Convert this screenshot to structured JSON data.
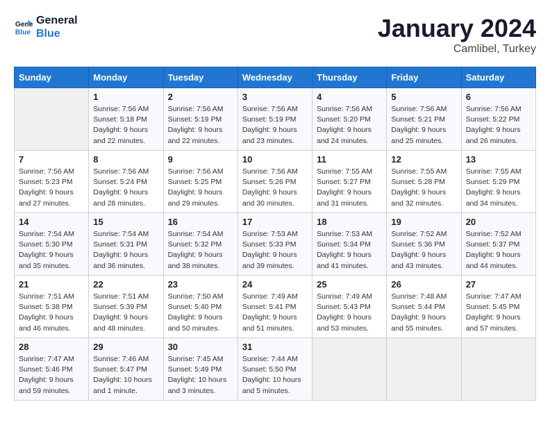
{
  "header": {
    "logo_line1": "General",
    "logo_line2": "Blue",
    "title": "January 2024",
    "subtitle": "Camlibel, Turkey"
  },
  "weekdays": [
    "Sunday",
    "Monday",
    "Tuesday",
    "Wednesday",
    "Thursday",
    "Friday",
    "Saturday"
  ],
  "weeks": [
    [
      {
        "day": "",
        "sunrise": "",
        "sunset": "",
        "daylight": ""
      },
      {
        "day": "1",
        "sunrise": "Sunrise: 7:56 AM",
        "sunset": "Sunset: 5:18 PM",
        "daylight": "Daylight: 9 hours and 22 minutes."
      },
      {
        "day": "2",
        "sunrise": "Sunrise: 7:56 AM",
        "sunset": "Sunset: 5:19 PM",
        "daylight": "Daylight: 9 hours and 22 minutes."
      },
      {
        "day": "3",
        "sunrise": "Sunrise: 7:56 AM",
        "sunset": "Sunset: 5:19 PM",
        "daylight": "Daylight: 9 hours and 23 minutes."
      },
      {
        "day": "4",
        "sunrise": "Sunrise: 7:56 AM",
        "sunset": "Sunset: 5:20 PM",
        "daylight": "Daylight: 9 hours and 24 minutes."
      },
      {
        "day": "5",
        "sunrise": "Sunrise: 7:56 AM",
        "sunset": "Sunset: 5:21 PM",
        "daylight": "Daylight: 9 hours and 25 minutes."
      },
      {
        "day": "6",
        "sunrise": "Sunrise: 7:56 AM",
        "sunset": "Sunset: 5:22 PM",
        "daylight": "Daylight: 9 hours and 26 minutes."
      }
    ],
    [
      {
        "day": "7",
        "sunrise": "Sunrise: 7:56 AM",
        "sunset": "Sunset: 5:23 PM",
        "daylight": "Daylight: 9 hours and 27 minutes."
      },
      {
        "day": "8",
        "sunrise": "Sunrise: 7:56 AM",
        "sunset": "Sunset: 5:24 PM",
        "daylight": "Daylight: 9 hours and 28 minutes."
      },
      {
        "day": "9",
        "sunrise": "Sunrise: 7:56 AM",
        "sunset": "Sunset: 5:25 PM",
        "daylight": "Daylight: 9 hours and 29 minutes."
      },
      {
        "day": "10",
        "sunrise": "Sunrise: 7:56 AM",
        "sunset": "Sunset: 5:26 PM",
        "daylight": "Daylight: 9 hours and 30 minutes."
      },
      {
        "day": "11",
        "sunrise": "Sunrise: 7:55 AM",
        "sunset": "Sunset: 5:27 PM",
        "daylight": "Daylight: 9 hours and 31 minutes."
      },
      {
        "day": "12",
        "sunrise": "Sunrise: 7:55 AM",
        "sunset": "Sunset: 5:28 PM",
        "daylight": "Daylight: 9 hours and 32 minutes."
      },
      {
        "day": "13",
        "sunrise": "Sunrise: 7:55 AM",
        "sunset": "Sunset: 5:29 PM",
        "daylight": "Daylight: 9 hours and 34 minutes."
      }
    ],
    [
      {
        "day": "14",
        "sunrise": "Sunrise: 7:54 AM",
        "sunset": "Sunset: 5:30 PM",
        "daylight": "Daylight: 9 hours and 35 minutes."
      },
      {
        "day": "15",
        "sunrise": "Sunrise: 7:54 AM",
        "sunset": "Sunset: 5:31 PM",
        "daylight": "Daylight: 9 hours and 36 minutes."
      },
      {
        "day": "16",
        "sunrise": "Sunrise: 7:54 AM",
        "sunset": "Sunset: 5:32 PM",
        "daylight": "Daylight: 9 hours and 38 minutes."
      },
      {
        "day": "17",
        "sunrise": "Sunrise: 7:53 AM",
        "sunset": "Sunset: 5:33 PM",
        "daylight": "Daylight: 9 hours and 39 minutes."
      },
      {
        "day": "18",
        "sunrise": "Sunrise: 7:53 AM",
        "sunset": "Sunset: 5:34 PM",
        "daylight": "Daylight: 9 hours and 41 minutes."
      },
      {
        "day": "19",
        "sunrise": "Sunrise: 7:52 AM",
        "sunset": "Sunset: 5:36 PM",
        "daylight": "Daylight: 9 hours and 43 minutes."
      },
      {
        "day": "20",
        "sunrise": "Sunrise: 7:52 AM",
        "sunset": "Sunset: 5:37 PM",
        "daylight": "Daylight: 9 hours and 44 minutes."
      }
    ],
    [
      {
        "day": "21",
        "sunrise": "Sunrise: 7:51 AM",
        "sunset": "Sunset: 5:38 PM",
        "daylight": "Daylight: 9 hours and 46 minutes."
      },
      {
        "day": "22",
        "sunrise": "Sunrise: 7:51 AM",
        "sunset": "Sunset: 5:39 PM",
        "daylight": "Daylight: 9 hours and 48 minutes."
      },
      {
        "day": "23",
        "sunrise": "Sunrise: 7:50 AM",
        "sunset": "Sunset: 5:40 PM",
        "daylight": "Daylight: 9 hours and 50 minutes."
      },
      {
        "day": "24",
        "sunrise": "Sunrise: 7:49 AM",
        "sunset": "Sunset: 5:41 PM",
        "daylight": "Daylight: 9 hours and 51 minutes."
      },
      {
        "day": "25",
        "sunrise": "Sunrise: 7:49 AM",
        "sunset": "Sunset: 5:43 PM",
        "daylight": "Daylight: 9 hours and 53 minutes."
      },
      {
        "day": "26",
        "sunrise": "Sunrise: 7:48 AM",
        "sunset": "Sunset: 5:44 PM",
        "daylight": "Daylight: 9 hours and 55 minutes."
      },
      {
        "day": "27",
        "sunrise": "Sunrise: 7:47 AM",
        "sunset": "Sunset: 5:45 PM",
        "daylight": "Daylight: 9 hours and 57 minutes."
      }
    ],
    [
      {
        "day": "28",
        "sunrise": "Sunrise: 7:47 AM",
        "sunset": "Sunset: 5:46 PM",
        "daylight": "Daylight: 9 hours and 59 minutes."
      },
      {
        "day": "29",
        "sunrise": "Sunrise: 7:46 AM",
        "sunset": "Sunset: 5:47 PM",
        "daylight": "Daylight: 10 hours and 1 minute."
      },
      {
        "day": "30",
        "sunrise": "Sunrise: 7:45 AM",
        "sunset": "Sunset: 5:49 PM",
        "daylight": "Daylight: 10 hours and 3 minutes."
      },
      {
        "day": "31",
        "sunrise": "Sunrise: 7:44 AM",
        "sunset": "Sunset: 5:50 PM",
        "daylight": "Daylight: 10 hours and 5 minutes."
      },
      {
        "day": "",
        "sunrise": "",
        "sunset": "",
        "daylight": ""
      },
      {
        "day": "",
        "sunrise": "",
        "sunset": "",
        "daylight": ""
      },
      {
        "day": "",
        "sunrise": "",
        "sunset": "",
        "daylight": ""
      }
    ]
  ]
}
